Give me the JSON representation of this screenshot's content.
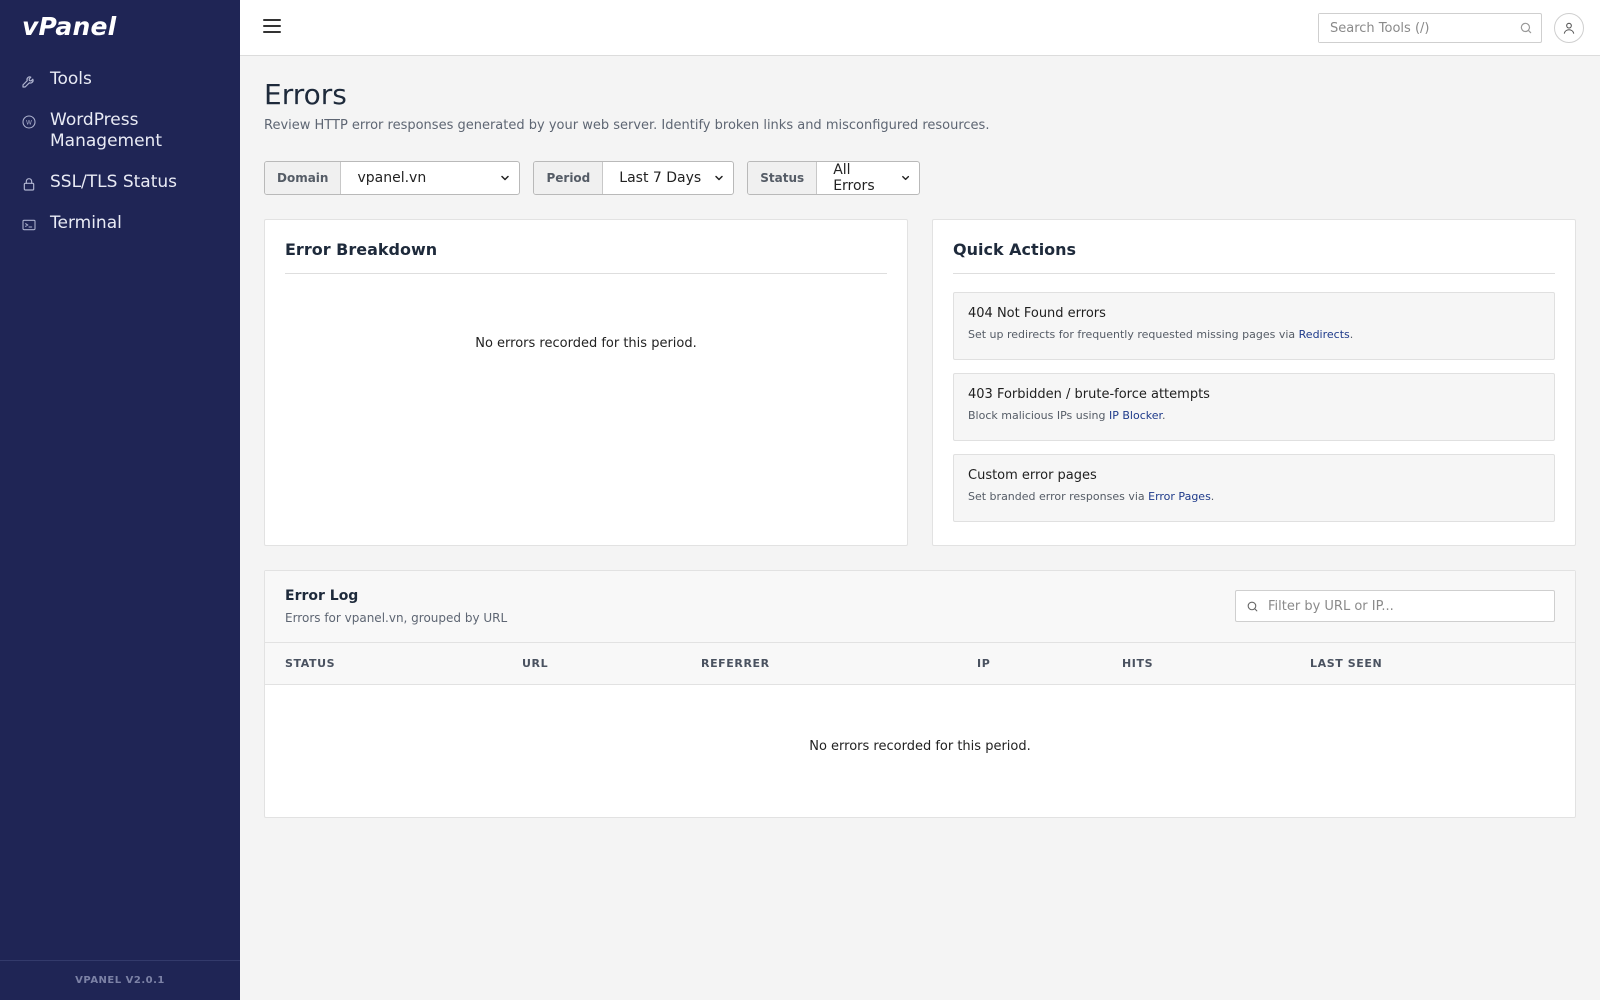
{
  "app": {
    "logo": "vPanel",
    "version": "VPANEL V2.0.1"
  },
  "sidebar": {
    "items": [
      {
        "label": "Tools",
        "icon": "wrench-icon"
      },
      {
        "label": "WordPress Management",
        "icon": "wordpress-icon"
      },
      {
        "label": "SSL/TLS Status",
        "icon": "lock-icon"
      },
      {
        "label": "Terminal",
        "icon": "terminal-icon"
      }
    ]
  },
  "topbar": {
    "search_placeholder": "Search Tools (/)"
  },
  "page": {
    "title": "Errors",
    "description": "Review HTTP error responses generated by your web server. Identify broken links and misconfigured resources."
  },
  "filters": {
    "domain": {
      "label": "Domain",
      "value": "vpanel.vn"
    },
    "period": {
      "label": "Period",
      "value": "Last 7 Days"
    },
    "status": {
      "label": "Status",
      "value": "All Errors"
    }
  },
  "breakdown": {
    "title": "Error Breakdown",
    "empty": "No errors recorded for this period."
  },
  "quick_actions": {
    "title": "Quick Actions",
    "items": [
      {
        "title": "404 Not Found errors",
        "desc_prefix": "Set up redirects for frequently requested missing pages via ",
        "link": "Redirects",
        "desc_suffix": "."
      },
      {
        "title": "403 Forbidden / brute-force attempts",
        "desc_prefix": "Block malicious IPs using ",
        "link": "IP Blocker",
        "desc_suffix": "."
      },
      {
        "title": "Custom error pages",
        "desc_prefix": "Set branded error responses via ",
        "link": "Error Pages",
        "desc_suffix": "."
      }
    ]
  },
  "error_log": {
    "title": "Error Log",
    "subtitle": "Errors for vpanel.vn, grouped by URL",
    "filter_placeholder": "Filter by URL or IP...",
    "columns": [
      "STATUS",
      "URL",
      "REFERRER",
      "IP",
      "HITS",
      "LAST SEEN"
    ],
    "empty": "No errors recorded for this period."
  },
  "colors": {
    "sidebar_bg": "#1f2555",
    "link": "#1e3a8a",
    "page_bg": "#f4f4f4"
  }
}
